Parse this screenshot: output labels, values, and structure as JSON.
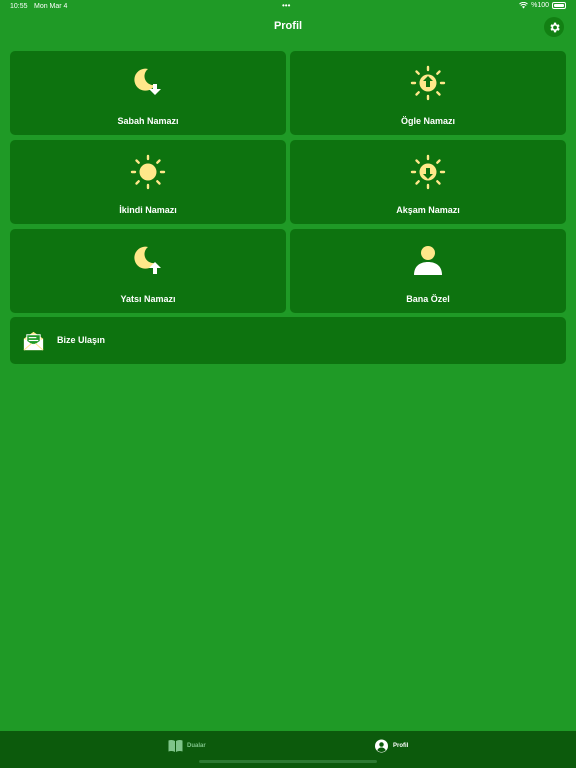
{
  "status_bar": {
    "time": "10:55",
    "date": "Mon Mar 4",
    "dots": "•••",
    "battery": "%100"
  },
  "header": {
    "title": "Profil"
  },
  "cards": [
    {
      "label": "Sabah Namazı",
      "icon": "moon-arrow-down-icon"
    },
    {
      "label": "Ögle Namazı",
      "icon": "sun-arrow-up-icon"
    },
    {
      "label": "İkindi Namazı",
      "icon": "sun-icon"
    },
    {
      "label": "Akşam Namazı",
      "icon": "sun-arrow-down-icon"
    },
    {
      "label": "Yatsı Namazı",
      "icon": "moon-arrow-up-icon"
    },
    {
      "label": "Bana Özel",
      "icon": "person-icon"
    }
  ],
  "contact": {
    "label": "Bize Ulaşın",
    "icon": "mail-icon"
  },
  "tabs": [
    {
      "label": "Dualar",
      "icon": "book-icon",
      "active": false
    },
    {
      "label": "Profil",
      "icon": "profile-icon",
      "active": true
    }
  ],
  "colors": {
    "background": "#1f9a26",
    "card": "#0d730f",
    "tab_bar": "#0c5a0c",
    "icon_yellow": "#ffe88a",
    "icon_white": "#ffffff"
  }
}
